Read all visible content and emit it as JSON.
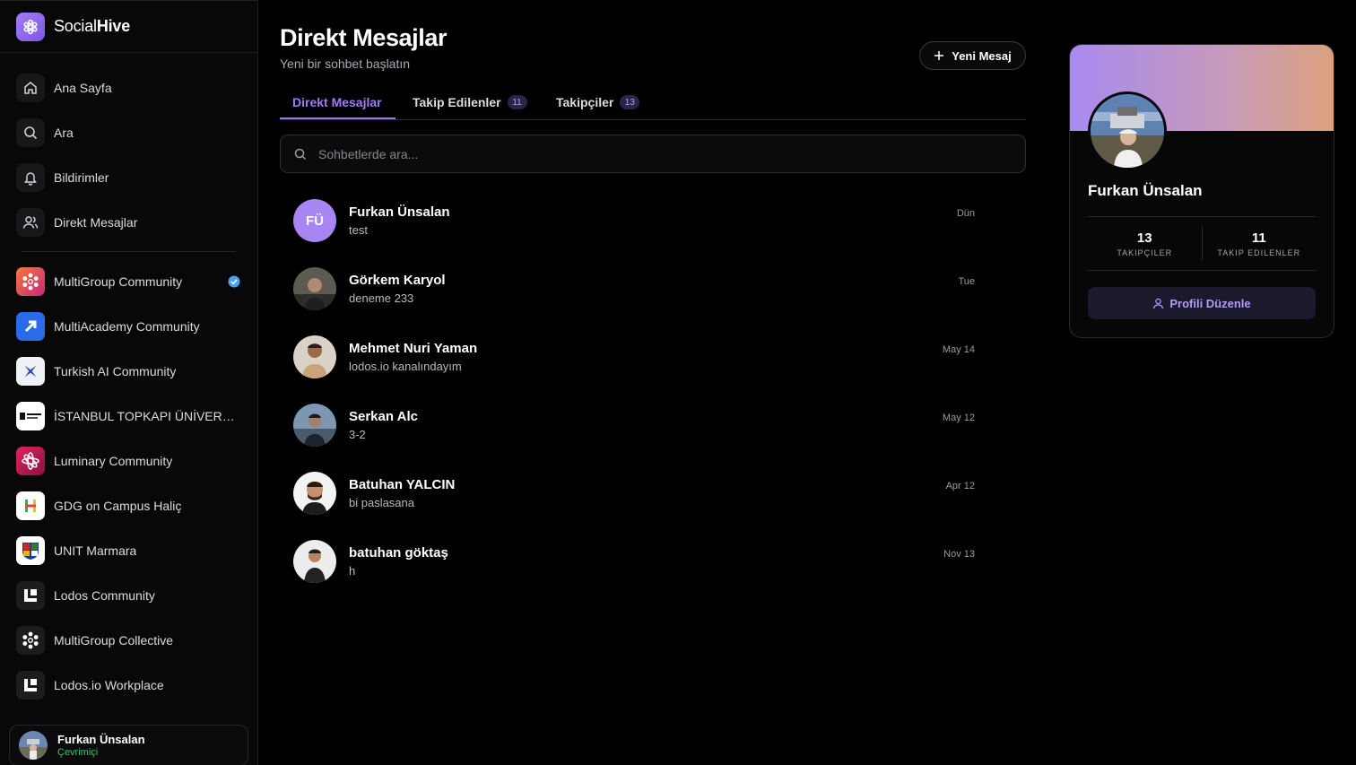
{
  "app": {
    "name_plain": "Social",
    "name_bold": "Hive"
  },
  "sidebar": {
    "nav": [
      {
        "label": "Ana Sayfa",
        "icon": "home-icon"
      },
      {
        "label": "Ara",
        "icon": "search-icon"
      },
      {
        "label": "Bildirimler",
        "icon": "bell-icon"
      },
      {
        "label": "Direkt Mesajlar",
        "icon": "users-icon"
      }
    ],
    "communities": [
      {
        "label": "MultiGroup Community",
        "verified": true
      },
      {
        "label": "MultiAcademy Community"
      },
      {
        "label": "Turkish AI Community"
      },
      {
        "label": "İSTANBUL TOPKAPI ÜNİVERSİ..."
      },
      {
        "label": "Luminary Community"
      },
      {
        "label": "GDG on Campus Haliç"
      },
      {
        "label": "UNIT Marmara"
      },
      {
        "label": "Lodos Community"
      },
      {
        "label": "MultiGroup Collective"
      },
      {
        "label": "Lodos.io Workplace"
      }
    ],
    "user": {
      "name": "Furkan Ünsalan",
      "status": "Çevrimiçi"
    }
  },
  "main": {
    "title": "Direkt Mesajlar",
    "subtitle": "Yeni bir sohbet başlatın",
    "new_message_label": "Yeni Mesaj",
    "tabs": [
      {
        "label": "Direkt Mesajlar"
      },
      {
        "label": "Takip Edilenler",
        "badge": "11"
      },
      {
        "label": "Takipçiler",
        "badge": "13"
      }
    ],
    "search": {
      "placeholder": "Sohbetlerde ara...",
      "value": ""
    },
    "conversations": [
      {
        "name": "Furkan Ünsalan",
        "preview": "test",
        "time": "Dün",
        "initials": "FÜ"
      },
      {
        "name": "Görkem Karyol",
        "preview": "deneme 233",
        "time": "Tue"
      },
      {
        "name": "Mehmet Nuri Yaman",
        "preview": "lodos.io kanalındayım",
        "time": "May 14"
      },
      {
        "name": "Serkan Alc",
        "preview": "3-2",
        "time": "May 12"
      },
      {
        "name": "Batuhan YALCIN",
        "preview": "bi paslasana",
        "time": "Apr 12"
      },
      {
        "name": "batuhan göktaş",
        "preview": "h",
        "time": "Nov 13"
      }
    ]
  },
  "profile": {
    "name": "Furkan Ünsalan",
    "followers_count": "13",
    "followers_label": "TAKIPÇILER",
    "following_count": "11",
    "following_label": "TAKIP EDILENLER",
    "edit_label": "Profili Düzenle"
  },
  "colors": {
    "accent": "#9d77f0",
    "online": "#3fc26b",
    "verified": "#4aa3f0"
  }
}
